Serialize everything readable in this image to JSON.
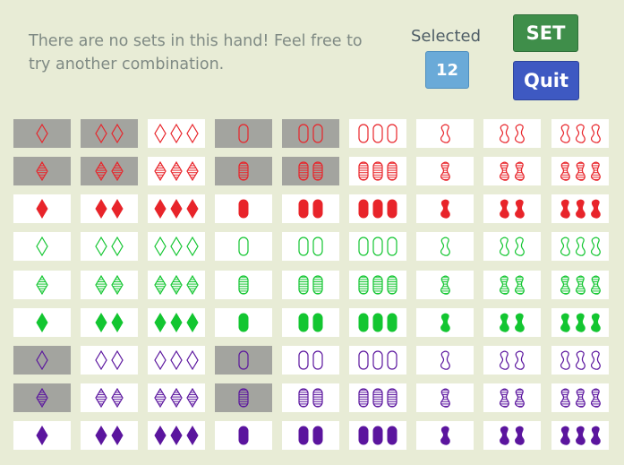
{
  "status": {
    "message": "There are no sets in this hand! Feel free to try another combination."
  },
  "selected": {
    "label": "Selected",
    "count": "12"
  },
  "buttons": {
    "set_label": "SET",
    "quit_label": "Quit"
  },
  "colors": {
    "red": "#e8242a",
    "green": "#13c631",
    "purple": "#5b159e",
    "selected_card": "#a3a49f",
    "card": "#ffffff",
    "background": "#e8ecd6"
  },
  "cards": {
    "shapes": [
      "diamond",
      "oval",
      "squiggle"
    ],
    "counts": [
      1,
      2,
      3
    ],
    "colors": [
      "red",
      "green",
      "purple"
    ],
    "shadings": [
      "outline",
      "striped",
      "solid"
    ],
    "selected": [
      {
        "row": 0,
        "col": 0
      },
      {
        "row": 0,
        "col": 1
      },
      {
        "row": 0,
        "col": 3
      },
      {
        "row": 0,
        "col": 4
      },
      {
        "row": 1,
        "col": 0
      },
      {
        "row": 1,
        "col": 1
      },
      {
        "row": 1,
        "col": 3
      },
      {
        "row": 1,
        "col": 4
      },
      {
        "row": 6,
        "col": 0
      },
      {
        "row": 6,
        "col": 3
      },
      {
        "row": 7,
        "col": 0
      },
      {
        "row": 7,
        "col": 3
      }
    ]
  }
}
